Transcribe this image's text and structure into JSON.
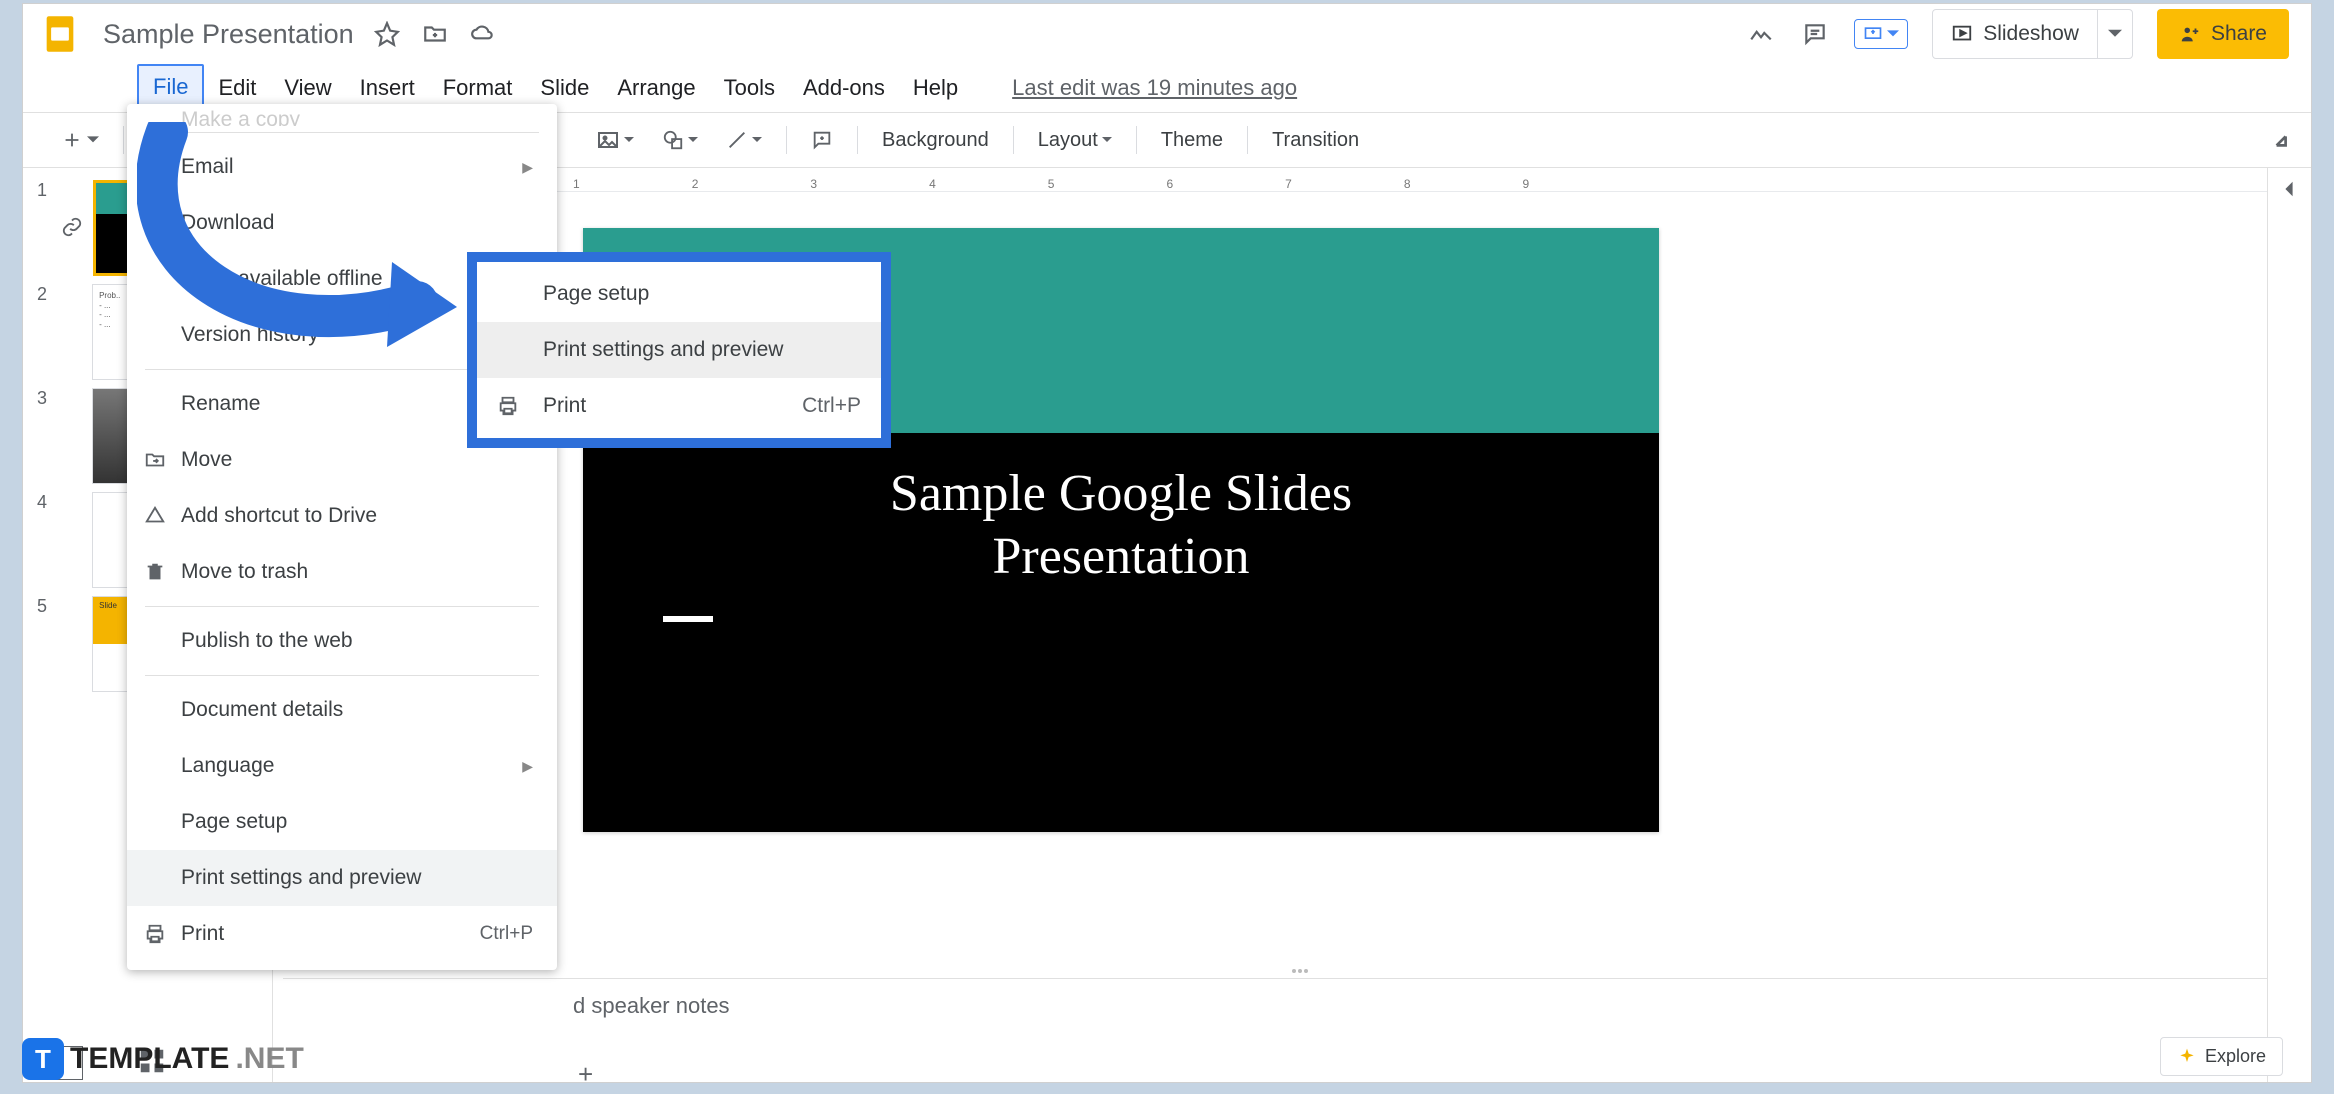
{
  "doc_title": "Sample Presentation",
  "menus": {
    "file": "File",
    "edit": "Edit",
    "view": "View",
    "insert": "Insert",
    "format": "Format",
    "slide": "Slide",
    "arrange": "Arrange",
    "tools": "Tools",
    "addons": "Add-ons",
    "help": "Help"
  },
  "last_edit": "Last edit was 19 minutes ago",
  "toolbar": {
    "background": "Background",
    "layout": "Layout",
    "theme": "Theme",
    "transition": "Transition"
  },
  "filemenu": {
    "email": "Email",
    "download": "Download",
    "make_offline": "Make available offline",
    "version_history": "Version history",
    "rename": "Rename",
    "move": "Move",
    "shortcut": "Add shortcut to Drive",
    "trash": "Move to trash",
    "publish": "Publish to the web",
    "doc_details": "Document details",
    "language": "Language",
    "page_setup": "Page setup",
    "print_settings": "Print settings and preview",
    "print": "Print",
    "print_shortcut": "Ctrl+P",
    "make_copy_partial": "Make a copy"
  },
  "submenu": {
    "page_setup": "Page setup",
    "print_settings": "Print settings and preview",
    "print": "Print",
    "sc": "Ctrl+P"
  },
  "slide_content": {
    "title_l1": "Sample Google Slides",
    "title_l2": "Presentation"
  },
  "header_right": {
    "slideshow": "Slideshow",
    "share": "Share"
  },
  "notes_placeholder": "speaker notes",
  "notes_prefix": "d ",
  "explore": "Explore",
  "badge": {
    "brand": "TEMPLATE",
    "suffix": ".NET"
  },
  "ruler": [
    "1",
    "2",
    "3",
    "4",
    "5",
    "6",
    "7",
    "8",
    "9"
  ],
  "slide_nums": [
    "1",
    "2",
    "3",
    "4",
    "5"
  ]
}
